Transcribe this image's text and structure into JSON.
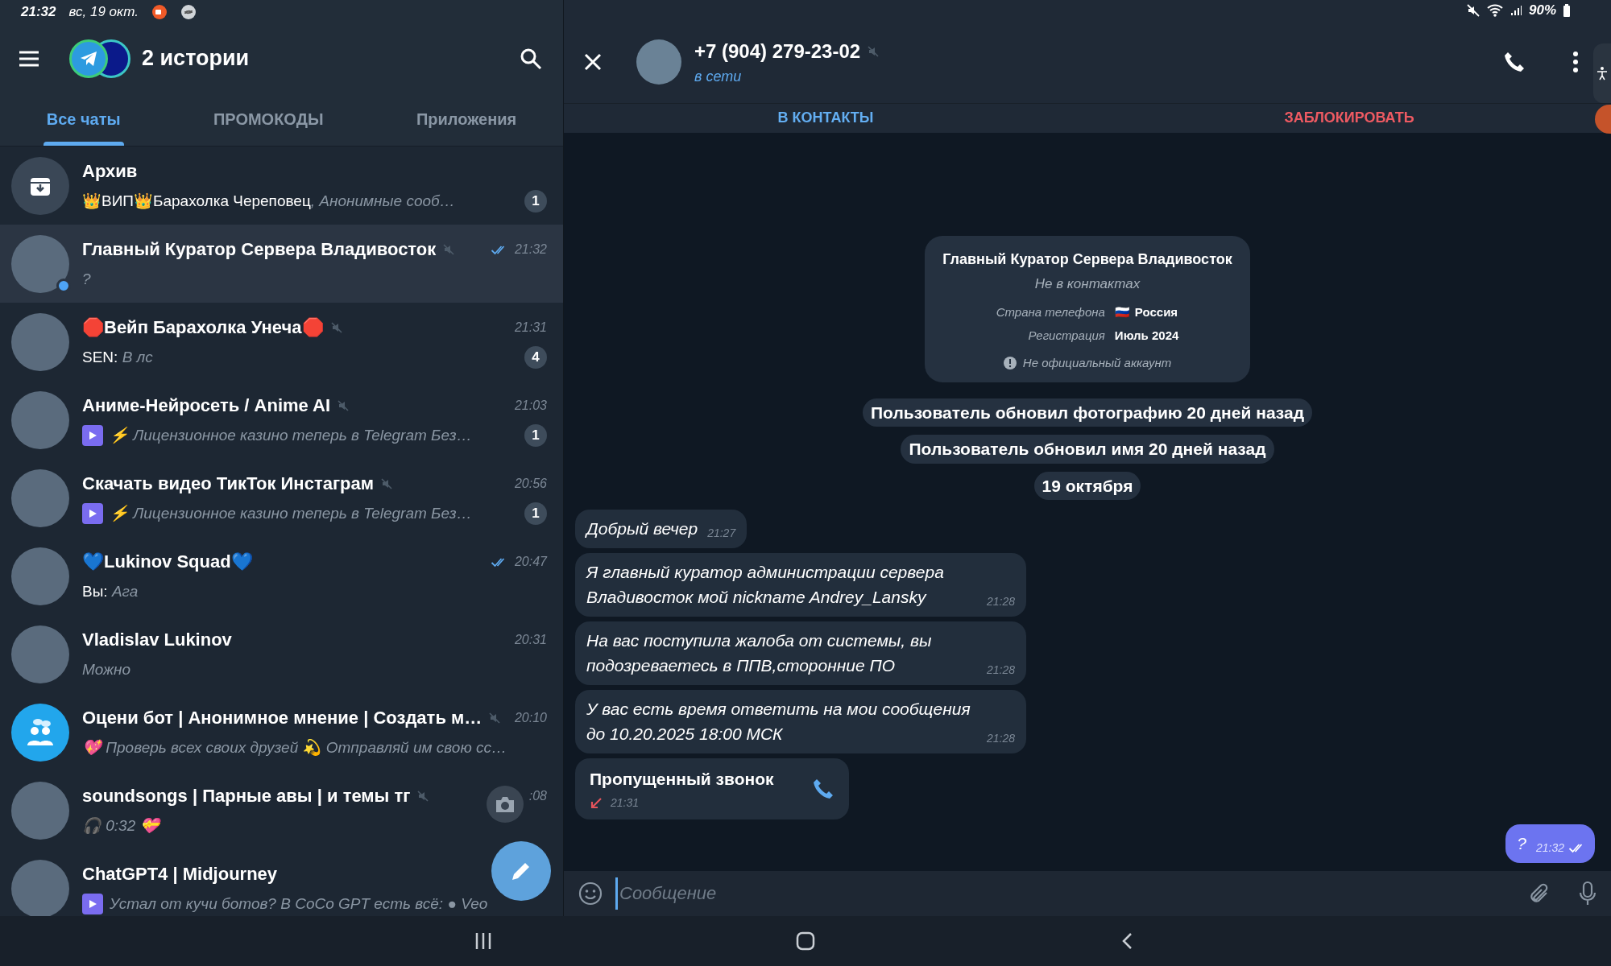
{
  "status_bar": {
    "time": "21:32",
    "date": "вс, 19 окт.",
    "battery": "90%"
  },
  "sidebar": {
    "title": "2 истории",
    "tabs": [
      {
        "label": "Все чаты",
        "selected": true
      },
      {
        "label": "ПРОМОКОДЫ",
        "selected": false
      },
      {
        "label": "Приложения",
        "selected": false
      }
    ],
    "chats": [
      {
        "kind": "archive",
        "name": "Архив",
        "sender": "👑ВИП👑Барахолка Череповец",
        "text": ", Анонимные сооб…",
        "badge": "1",
        "selected": false
      },
      {
        "kind": "photo",
        "name": "Главный Куратор Сервера Владивосток",
        "muted": true,
        "time": "21:32",
        "read": true,
        "text": "?",
        "online": true,
        "selected": true
      },
      {
        "kind": "photo",
        "name": "🛑Вейп Барахолка Унеча🛑",
        "muted": true,
        "time": "21:31",
        "sender": "SEN: ",
        "text": "В лс",
        "badge": "4",
        "selected": false
      },
      {
        "kind": "photo",
        "name": "Аниме-Нейросеть / Anime AI",
        "muted": true,
        "time": "21:03",
        "text": "⚡ Лицензионное казино теперь в Telegram  Без…",
        "media": true,
        "badge": "1",
        "selected": false
      },
      {
        "kind": "photo",
        "name": "Скачать видео ТикТок Инстаграм",
        "muted": true,
        "time": "20:56",
        "text": "⚡ Лицензионное казино теперь в Telegram  Без…",
        "media": true,
        "badge": "1",
        "selected": false
      },
      {
        "kind": "photo",
        "name": "💙Lukinov Squad💙",
        "time": "20:47",
        "read": true,
        "sender": "Вы: ",
        "text": "Ага",
        "selected": false
      },
      {
        "kind": "photo",
        "name": "Vladislav Lukinov",
        "time": "20:31",
        "text": "Можно",
        "selected": false
      },
      {
        "kind": "group",
        "name": "Оцени бот | Анонимное мнение | Создать м…",
        "muted": true,
        "time": "20:10",
        "text": "💖 Проверь всех своих друзей  💫 Отправляй им свою сс…",
        "selected": false
      },
      {
        "kind": "photo",
        "name": "soundsongs | Парные авы | и темы тг",
        "muted": true,
        "time": ":08",
        "text": "🎧 0:32 💝",
        "selected": false
      },
      {
        "kind": "photo",
        "name": "ChatGPT4 | Midjourney",
        "text": "Устал от кучи ботов?  В CoCo GPT есть всё: ● Veo",
        "media": true,
        "selected": false
      }
    ]
  },
  "chat": {
    "title": "+7 (904) 279-23-02",
    "muted": true,
    "status": "в сети",
    "actions": [
      {
        "label": "В КОНТАКТЫ",
        "kind": "add"
      },
      {
        "label": "ЗАБЛОКИРОВАТЬ",
        "kind": "block"
      }
    ],
    "profile_card": {
      "name": "Главный Куратор Сервера Владивосток",
      "subtitle": "Не в контактах",
      "rows": [
        {
          "label": "Страна телефона",
          "flag": "🇷🇺",
          "value": "Россия"
        },
        {
          "label": "Регистрация",
          "value": "Июль 2024"
        }
      ],
      "note": "Не официальный аккаунт"
    },
    "service_messages": [
      "Пользователь обновил фотографию 20 дней назад",
      "Пользователь обновил имя 20 дней назад",
      "19 октября"
    ],
    "messages": [
      {
        "kind": "text",
        "outgoing": false,
        "text": "Добрый вечер",
        "time": "21:27"
      },
      {
        "kind": "text",
        "outgoing": false,
        "text": "Я главный куратор администрации сервера Владивосток мой nickname Andrey_Lansky",
        "time": "21:28"
      },
      {
        "kind": "text",
        "outgoing": false,
        "text": "На вас поступила жалоба от системы, вы подозреваетесь в ППВ,сторонние ПО",
        "time": "21:28"
      },
      {
        "kind": "text",
        "outgoing": false,
        "text": "У вас есть время ответить на мои сообщения до 10.20.2025 18:00 МСК",
        "time": "21:28"
      },
      {
        "kind": "call",
        "outgoing": false,
        "text": "Пропущенный звонок",
        "time": "21:31"
      },
      {
        "kind": "text",
        "outgoing": true,
        "text": "?",
        "time": "21:32",
        "read": true
      }
    ],
    "input": {
      "placeholder": "Сообщение"
    }
  }
}
